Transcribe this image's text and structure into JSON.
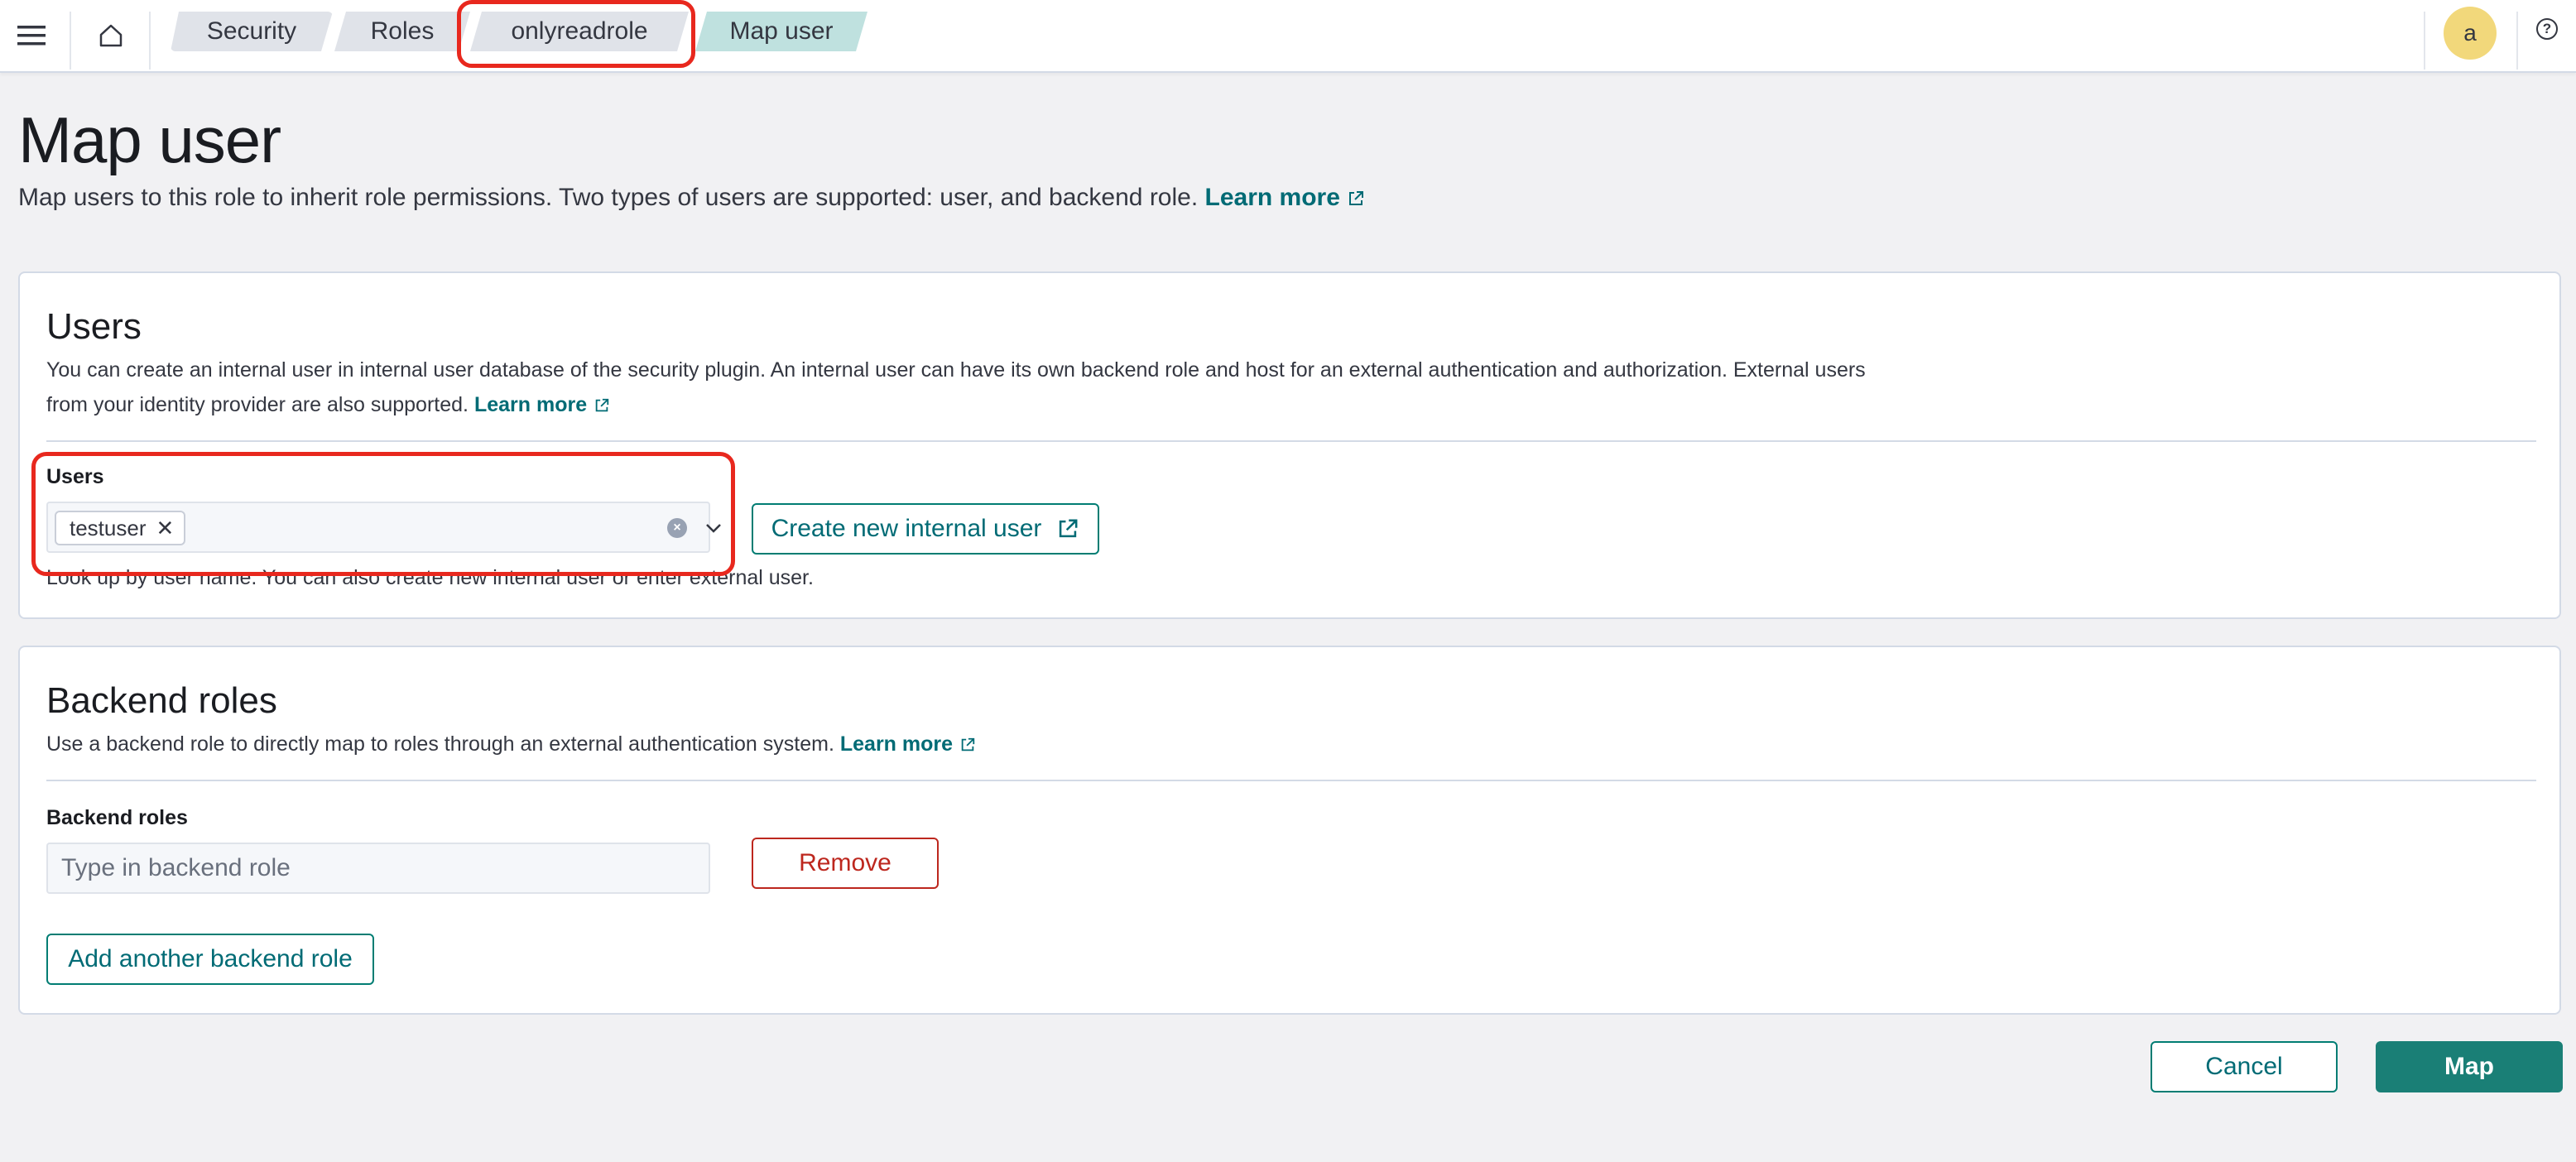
{
  "header": {
    "menu_icon": "hamburger-menu-icon",
    "home_icon": "home-icon",
    "breadcrumbs": [
      "Security",
      "Roles",
      "onlyreadrole",
      "Map user"
    ],
    "avatar_initial": "a",
    "help_icon": "help-icon"
  },
  "page": {
    "title": "Map user",
    "description": "Map users to this role to inherit role permissions. Two types of users are supported: user, and backend role.",
    "learn_more": "Learn more"
  },
  "users_panel": {
    "title": "Users",
    "description_line1": "You can create an internal user in internal user database of the security plugin. An internal user can have its own backend role and host for an external authentication and authorization. External users",
    "description_line2": "from your identity provider are also supported.",
    "learn_more": "Learn more",
    "field_label": "Users",
    "selected_users": [
      "testuser"
    ],
    "help_text": "Look up by user name. You can also create new internal user or enter external user.",
    "create_button": "Create new internal user"
  },
  "backend_panel": {
    "title": "Backend roles",
    "description": "Use a backend role to directly map to roles through an external authentication system.",
    "learn_more": "Learn more",
    "field_label": "Backend roles",
    "input_placeholder": "Type in backend role",
    "remove_button": "Remove",
    "add_button": "Add another backend role"
  },
  "footer": {
    "cancel_button": "Cancel",
    "map_button": "Map"
  },
  "colors": {
    "accent": "#006b75",
    "primary_button": "#1a7f76",
    "danger": "#bd271e",
    "highlight": "#e8281e",
    "avatar": "#f2d87b"
  }
}
